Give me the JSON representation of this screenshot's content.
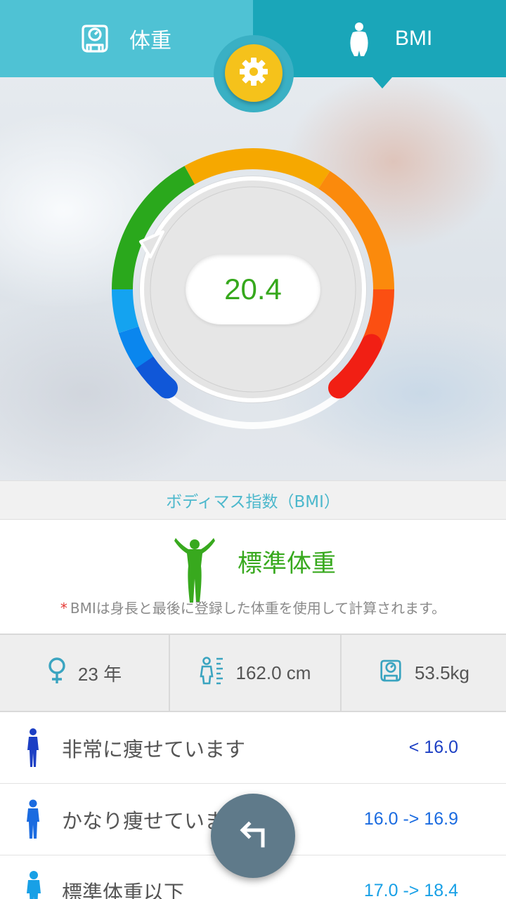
{
  "tabs": [
    {
      "label": "体重",
      "icon": "scale-icon"
    },
    {
      "label": "BMI",
      "icon": "person-icon"
    }
  ],
  "settings": {
    "icon": "gear-icon"
  },
  "gauge": {
    "value": "20.4",
    "value_color": "#36a81c"
  },
  "section": {
    "title": "ボディマス指数（BMI）"
  },
  "status": {
    "label": "標準体重",
    "color": "#38a91e"
  },
  "note": {
    "star": "*",
    "text": "BMIは身長と最後に登録した体重を使用して計算されます。"
  },
  "stats": [
    {
      "icon": "female-icon",
      "text": "23 年"
    },
    {
      "icon": "height-icon",
      "text": "162.0 cm"
    },
    {
      "icon": "scale-icon",
      "text": "53.5kg"
    }
  ],
  "categories": [
    {
      "label": "非常に痩せています",
      "range": "< 16.0",
      "color": "#1c3fc4"
    },
    {
      "label": "かなり痩せています",
      "range": "16.0 -> 16.9",
      "color": "#1a6be0"
    },
    {
      "label": "標準体重以下",
      "range": "17.0 -> 18.4",
      "color": "#18a0e6"
    }
  ],
  "back": {
    "icon": "back-arrow-icon"
  }
}
